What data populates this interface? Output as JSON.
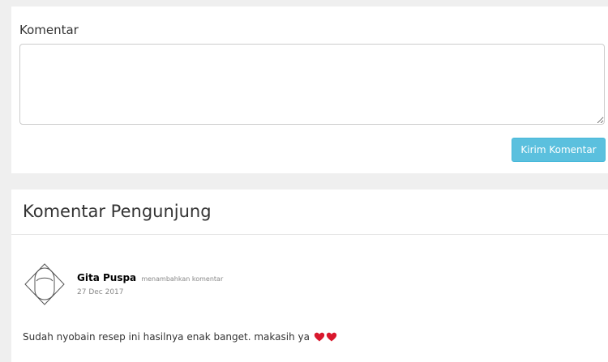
{
  "form": {
    "label": "Komentar",
    "textarea_value": "",
    "submit_label": "Kirim Komentar"
  },
  "comments_section": {
    "title": "Komentar Pengunjung",
    "comments": [
      {
        "name": "Gita Puspa",
        "action": "menambahkan komentar",
        "date": "27 Dec 2017",
        "text": "Sudah nyobain resep ini hasilnya enak banget. makasih ya",
        "emojis": [
          "heart-icon",
          "heart-icon"
        ]
      }
    ]
  },
  "colors": {
    "submit_button": "#5bc0de",
    "background": "#efefef",
    "panel": "#ffffff",
    "heart": "#d9182d"
  }
}
